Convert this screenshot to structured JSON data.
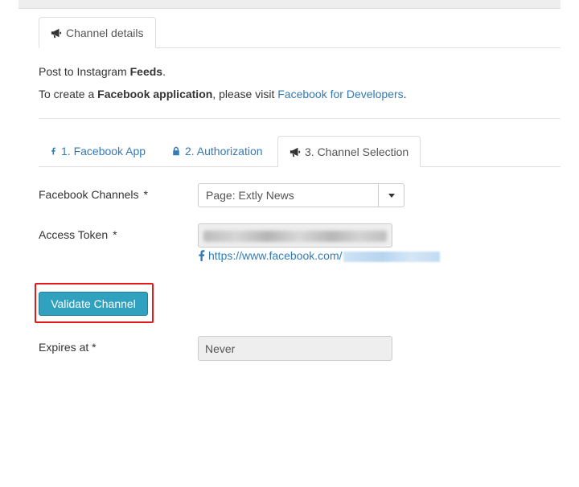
{
  "top_tab": {
    "label": "Channel details",
    "icon": "bullhorn-icon"
  },
  "intro": {
    "line1_prefix": "Post to Instagram ",
    "line1_bold": "Feeds",
    "line1_suffix": ".",
    "line2_prefix": "To create a ",
    "line2_bold": "Facebook application",
    "line2_middle": ", please visit ",
    "line2_link": "Facebook for Developers",
    "line2_suffix": "."
  },
  "steps": [
    {
      "label": "1. Facebook App",
      "icon": "facebook-icon",
      "active": false
    },
    {
      "label": "2. Authorization",
      "icon": "lock-icon",
      "active": false
    },
    {
      "label": "3. Channel Selection",
      "icon": "bullhorn-icon",
      "active": true
    }
  ],
  "form": {
    "channels_label": "Facebook Channels",
    "required_mark": "*",
    "channels_value": "Page: Extly News",
    "token_label": "Access Token",
    "token_link_visible": "https://www.facebook.com/",
    "validate_label": "Validate Channel",
    "expires_label": "Expires at *",
    "expires_value": "Never"
  },
  "colors": {
    "link": "#337ab7",
    "button": "#31a1c0",
    "highlight": "#e31b1b"
  }
}
